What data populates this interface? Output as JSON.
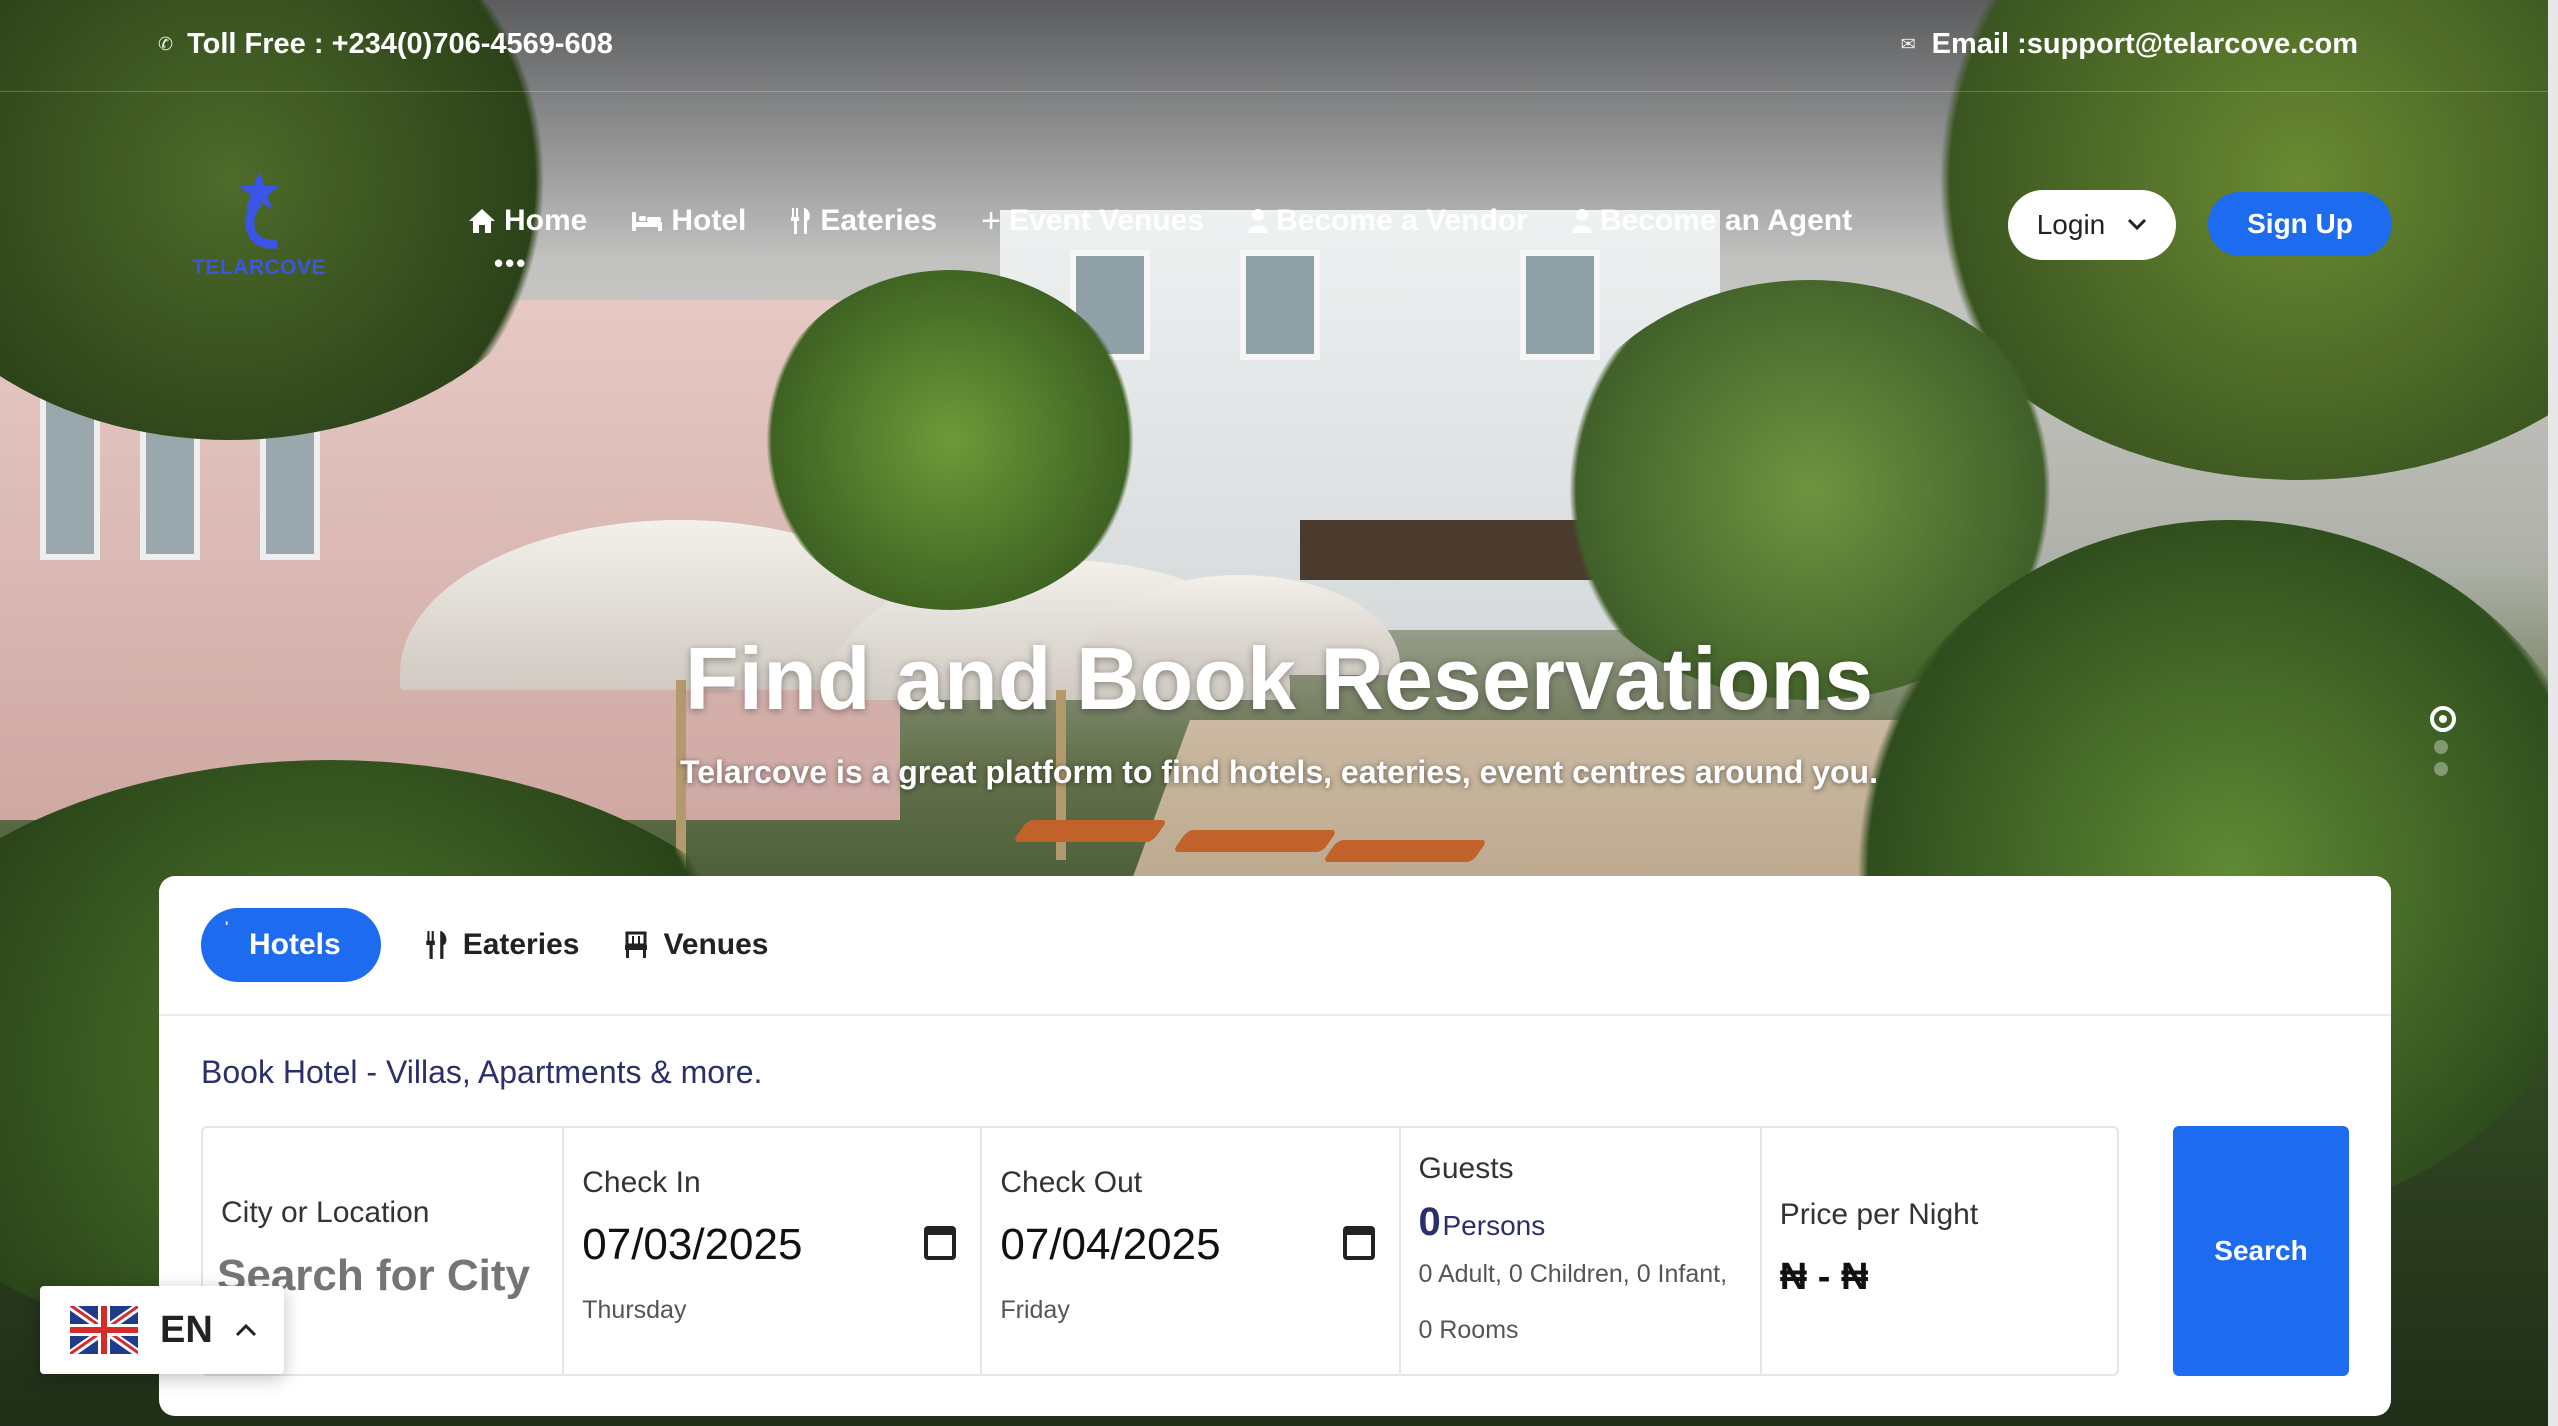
{
  "topbar": {
    "phone": "Toll Free : +234(0)706-4569-608",
    "phone_icon": "phone-icon",
    "email": "Email :support@telarcove.com",
    "email_icon": "mail-icon"
  },
  "logo": {
    "text": "TELARCOVE"
  },
  "nav": {
    "items": [
      {
        "label": "Home",
        "icon": "home-icon"
      },
      {
        "label": "Hotel",
        "icon": "bed-icon"
      },
      {
        "label": "Eateries",
        "icon": "utensils-icon"
      },
      {
        "label": "Event Venues",
        "icon": "plus-icon"
      },
      {
        "label": "Become a Vendor",
        "icon": "user-icon"
      },
      {
        "label": "Become an Agent",
        "icon": "user-icon"
      }
    ],
    "login": "Login",
    "signup": "Sign Up"
  },
  "hero": {
    "title_part1": "Find and ",
    "title_accent": "Book",
    "title_part2": " Reservations",
    "subtitle": "Telarcove is a great platform to find hotels, eateries, event centres around you.",
    "slides": 3,
    "active_slide": 1
  },
  "search": {
    "tabs": [
      {
        "label": "Hotels",
        "icon": "hotel-icon",
        "active": true
      },
      {
        "label": "Eateries",
        "icon": "utensils-icon",
        "active": false
      },
      {
        "label": "Venues",
        "icon": "venue-icon",
        "active": false
      }
    ],
    "tagline": "Book Hotel - Villas, Apartments & more.",
    "city": {
      "label": "City or Location",
      "placeholder": "Search for City"
    },
    "check_in": {
      "label": "Check In",
      "date": "07/03/2025",
      "day": "Thursday"
    },
    "check_out": {
      "label": "Check Out",
      "date": "07/04/2025",
      "day": "Friday"
    },
    "guests": {
      "label": "Guests",
      "count": "0",
      "unit": "Persons",
      "breakdown": "0 Adult, 0 Children, 0 Infant,",
      "rooms": "0 Rooms"
    },
    "price": {
      "label": "Price per Night",
      "range": "₦ - ₦"
    },
    "button": "Search"
  },
  "language": {
    "code": "EN",
    "flag": "uk-flag-icon"
  },
  "colors": {
    "primary": "#1d6cf0",
    "tagline": "#2b2f6a",
    "logo": "#3b55e6"
  }
}
